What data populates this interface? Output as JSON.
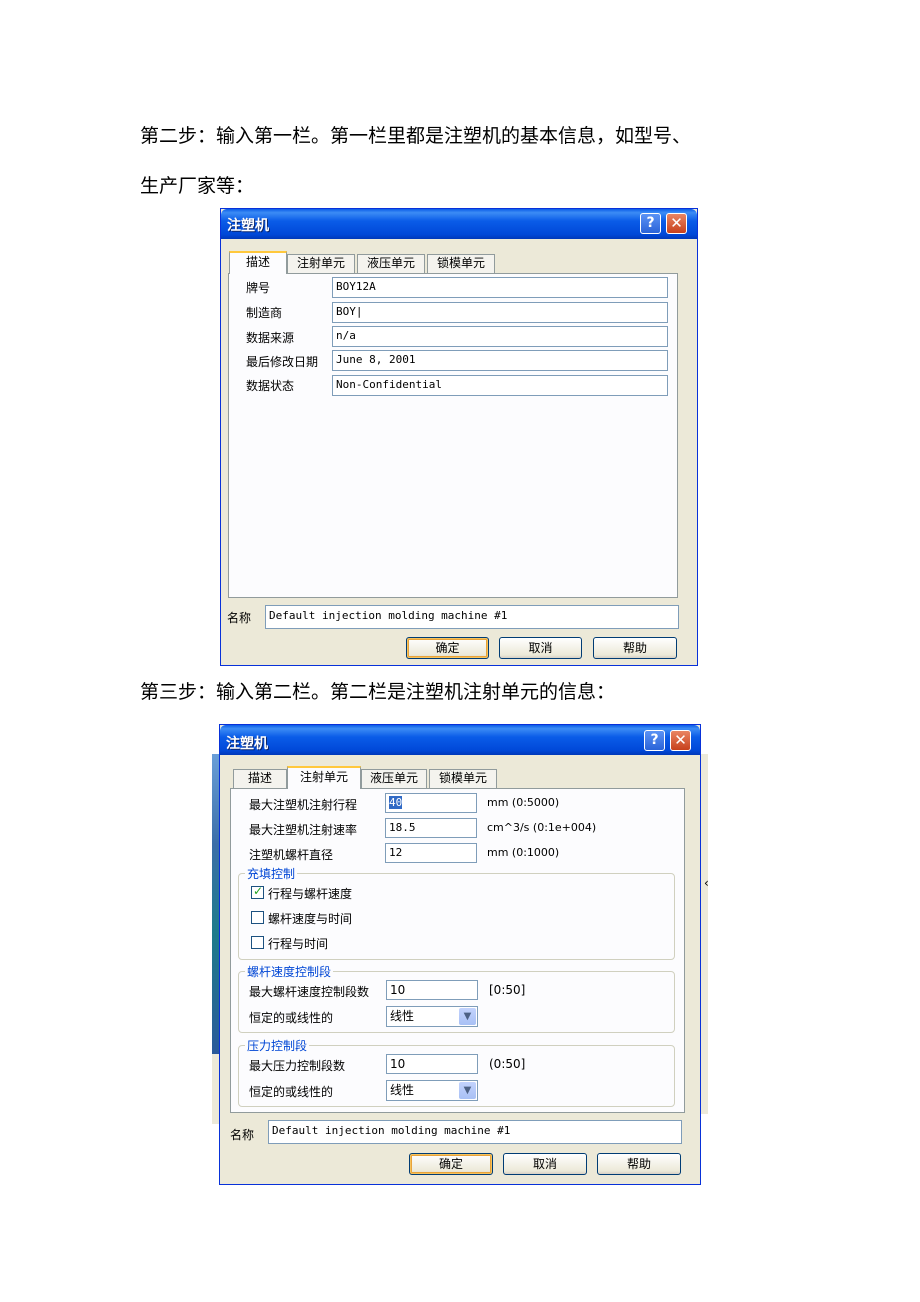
{
  "paragraphs": {
    "step2_line1": "第二步：输入第一栏。第一栏里都是注塑机的基本信息，如型号、",
    "step2_line2": "生产厂家等：",
    "step3": "第三步：输入第二栏。第二栏是注塑机注射单元的信息："
  },
  "dialog1": {
    "title": "注塑机",
    "help_glyph": "?",
    "close_glyph": "✕",
    "tabs": [
      "描述",
      "注射单元",
      "液压单元",
      "锁模单元"
    ],
    "active_tab": "描述",
    "fields": [
      {
        "label": "牌号",
        "value": "BOY12A"
      },
      {
        "label": "制造商",
        "value": "BOY|"
      },
      {
        "label": "数据来源",
        "value": "n/a"
      },
      {
        "label": "最后修改日期",
        "value": "June 8, 2001"
      },
      {
        "label": "数据状态",
        "value": "Non-Confidential"
      }
    ],
    "name_label": "名称",
    "name_value": "Default injection molding machine #1",
    "buttons": {
      "ok": "确定",
      "cancel": "取消",
      "help": "帮助"
    }
  },
  "dialog2": {
    "title": "注塑机",
    "help_glyph": "?",
    "close_glyph": "✕",
    "tabs": [
      "描述",
      "注射单元",
      "液压单元",
      "锁模单元"
    ],
    "active_tab": "注射单元",
    "fields": [
      {
        "label": "最大注塑机注射行程",
        "value": "40",
        "unit": "mm (0:5000)"
      },
      {
        "label": "最大注塑机注射速率",
        "value": "18.5",
        "unit": "cm^3/s (0:1e+004)"
      },
      {
        "label": "注塑机螺杆直径",
        "value": "12",
        "unit": "mm (0:1000)"
      }
    ],
    "fill_group": {
      "title": "充填控制",
      "options": [
        {
          "label": "行程与螺杆速度",
          "checked": true
        },
        {
          "label": "螺杆速度与时间",
          "checked": false
        },
        {
          "label": "行程与时间",
          "checked": false
        }
      ]
    },
    "screw_group": {
      "title": "螺杆速度控制段",
      "max_label": "最大螺杆速度控制段数",
      "max_value": "10",
      "max_range": "[0:50]",
      "mode_label": "恒定的或线性的",
      "mode_value": "线性"
    },
    "pressure_group": {
      "title": "压力控制段",
      "max_label": "最大压力控制段数",
      "max_value": "10",
      "max_range": "(0:50]",
      "mode_label": "恒定的或线性的",
      "mode_value": "线性"
    },
    "name_label": "名称",
    "name_value": "Default injection molding machine #1",
    "buttons": {
      "ok": "确定",
      "cancel": "取消",
      "help": "帮助"
    },
    "side_glyph": "‹"
  }
}
